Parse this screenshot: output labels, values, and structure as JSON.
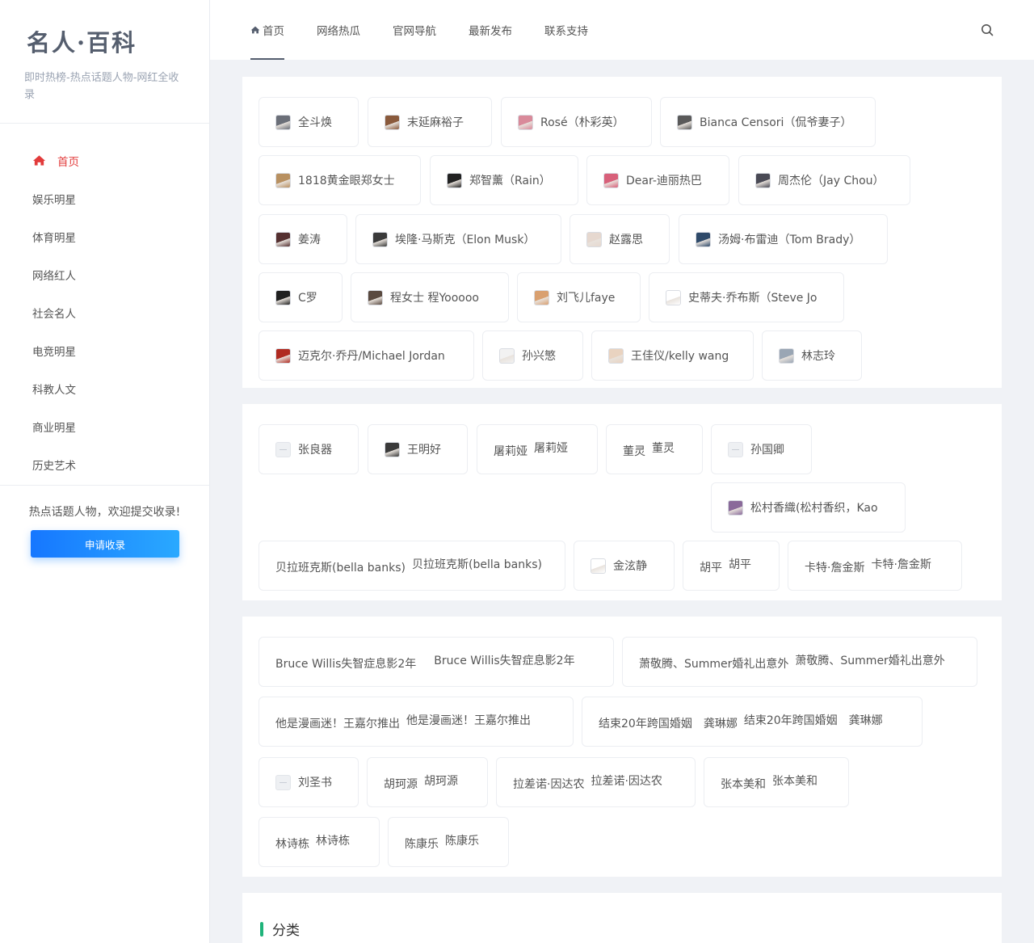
{
  "site": {
    "title": "名人·百科",
    "subtitle": "即时热榜-热点话题人物-网红全收录"
  },
  "sidebar": {
    "items": [
      {
        "label": "首页",
        "active": true
      },
      {
        "label": "娱乐明星"
      },
      {
        "label": "体育明星"
      },
      {
        "label": "网络红人"
      },
      {
        "label": "社会名人"
      },
      {
        "label": "电竞明星"
      },
      {
        "label": "科教人文"
      },
      {
        "label": "商业明星"
      },
      {
        "label": "历史艺术"
      }
    ],
    "note": "热点话题人物，欢迎提交收录!",
    "apply_label": "申请收录"
  },
  "topnav": {
    "items": [
      "首页",
      "网络热瓜",
      "官网导航",
      "最新发布",
      "联系支持"
    ],
    "search_icon": "search-icon"
  },
  "panel1": {
    "tags": [
      {
        "label": "全斗焕",
        "avatar": "#6b6f78"
      },
      {
        "label": "末延麻裕子",
        "avatar": "#8a5a3c"
      },
      {
        "label": "Rosé（朴彩英）",
        "avatar": "#d98a9a"
      },
      {
        "label": "Bianca Censori（侃爷妻子）",
        "avatar": "#5a5a5a"
      },
      {
        "label": "1818黄金眼郑女士",
        "avatar": "#b89060"
      },
      {
        "label": "郑智薰（Rain）",
        "avatar": "#222"
      },
      {
        "label": "Dear-迪丽热巴",
        "avatar": "#d8607a"
      },
      {
        "label": "周杰伦（Jay Chou）",
        "avatar": "#4a4a55"
      },
      {
        "label": "姜涛",
        "avatar": "#553030"
      },
      {
        "label": "埃隆·马斯克（Elon Musk）",
        "avatar": "#3a3a3a"
      },
      {
        "label": "赵露思",
        "avatar": "#e6d8cf"
      },
      {
        "label": "汤姆·布雷迪（Tom Brady）",
        "avatar": "#2f4a6a"
      },
      {
        "label": "C罗",
        "avatar": "#202020"
      },
      {
        "label": "程女士 程Yooooo",
        "avatar": "#5a4a40"
      },
      {
        "label": "刘飞儿faye",
        "avatar": "#d9a070"
      },
      {
        "label": "史蒂夫·乔布斯（Steve Jo",
        "avatar": "#ffffff"
      },
      {
        "label": "迈克尔·乔丹/Michael Jordan",
        "avatar": "#b02a20"
      },
      {
        "label": "孙兴慜",
        "avatar": "#f2f2f2"
      },
      {
        "label": "王佳仪/kelly wang",
        "avatar": "#e9d3c0"
      },
      {
        "label": "林志玲",
        "avatar": "#9aa6b4"
      }
    ]
  },
  "panel2": {
    "tags": [
      {
        "label": "张良器",
        "avatar": "placeholder"
      },
      {
        "label": "王明好",
        "avatar": "#3a3a3a"
      },
      {
        "label": "屠莉娅",
        "sub": "屠莉娅"
      },
      {
        "label": "董灵",
        "sub": "董灵"
      },
      {
        "label": "孙国卿",
        "avatar": "placeholder"
      },
      {
        "label": "松村香織(松村香织，Kao",
        "avatar": "#8a6a9a"
      },
      {
        "label": "贝拉班克斯(bella banks)",
        "sub": "贝拉班克斯(bella banks)"
      },
      {
        "label": "金泫静",
        "avatar": "#ffffff"
      },
      {
        "label": "胡平",
        "sub": "胡平"
      },
      {
        "label": "卡特·詹金斯",
        "sub": "卡特·詹金斯"
      }
    ]
  },
  "panel3": {
    "tags": [
      {
        "label": "Bruce Willis失智症息影2年",
        "sub": "Bruce Willis失智症息影2年"
      },
      {
        "label": "萧敬腾、Summer婚礼出意外",
        "sub": "萧敬腾、Summer婚礼出意外"
      },
      {
        "label": "他是漫画迷！王嘉尔推出",
        "sub": "他是漫画迷！王嘉尔推出"
      },
      {
        "label": "结束20年跨国婚姻　龚琳娜",
        "sub": "结束20年跨国婚姻　龚琳娜"
      },
      {
        "label": "刘圣书",
        "avatar": "placeholder"
      },
      {
        "label": "胡珂源",
        "sub": "胡珂源"
      },
      {
        "label": "拉差诺·因达农",
        "sub": "拉差诺·因达农"
      },
      {
        "label": "张本美和",
        "sub": "张本美和"
      },
      {
        "label": "林诗栋",
        "sub": "林诗栋"
      },
      {
        "label": "陈康乐",
        "sub": "陈康乐"
      }
    ]
  },
  "category": {
    "title": "分类"
  }
}
